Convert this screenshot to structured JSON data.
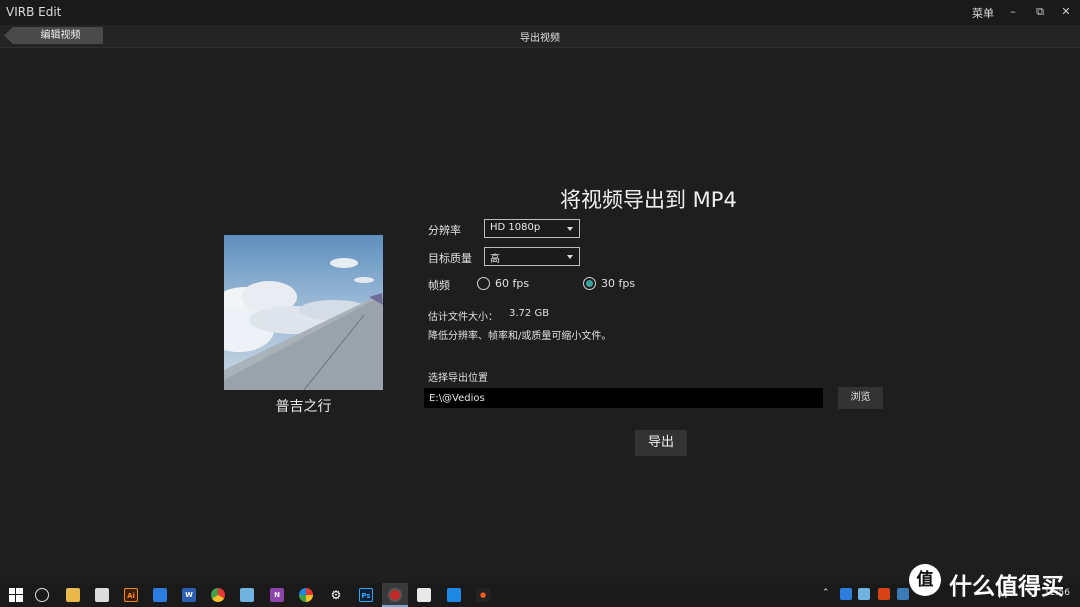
{
  "window": {
    "title": "VIRB Edit",
    "menu_label": "菜单",
    "controls": [
      "minimize-icon",
      "restore-icon",
      "close-icon"
    ]
  },
  "subbar": {
    "back_label": "编辑视频",
    "page_title": "导出视频"
  },
  "video": {
    "name": "普吉之行"
  },
  "export": {
    "heading": "将视频导出到 MP4",
    "resolution": {
      "label": "分辨率",
      "value": "HD 1080p"
    },
    "quality": {
      "label": "目标质量",
      "value": "高"
    },
    "framerate": {
      "label": "帧频",
      "options": [
        {
          "label": "60 fps",
          "selected": false
        },
        {
          "label": "30 fps",
          "selected": true
        }
      ]
    },
    "size_label": "估计文件大小：",
    "size_value": "3.72 GB",
    "hint": "降低分辨率、帧率和/或质量可缩小文件。",
    "location_label": "选择导出位置",
    "location_value": "E:\\@Vedios",
    "browse_label": "浏览",
    "export_label": "导出"
  },
  "taskbar": {
    "apps": [
      "start-icon",
      "cortana-icon",
      "file-explorer-icon",
      "chat-icon",
      "illustrator-icon",
      "security-shield-icon",
      "word-icon",
      "chrome-icon",
      "notepad-icon",
      "onenote-icon",
      "pinwheel-icon",
      "settings-icon",
      "photoshop-icon",
      "virb-icon",
      "photos-icon",
      "store-icon",
      "media-icon"
    ],
    "tray_language": "M",
    "clock": "12:56"
  },
  "watermark": {
    "logo_char": "值",
    "text": "什么值得买"
  },
  "colors": {
    "background": "#1e1e1e",
    "radio_accent": "#3aa3a0",
    "path_field": "#000000"
  }
}
